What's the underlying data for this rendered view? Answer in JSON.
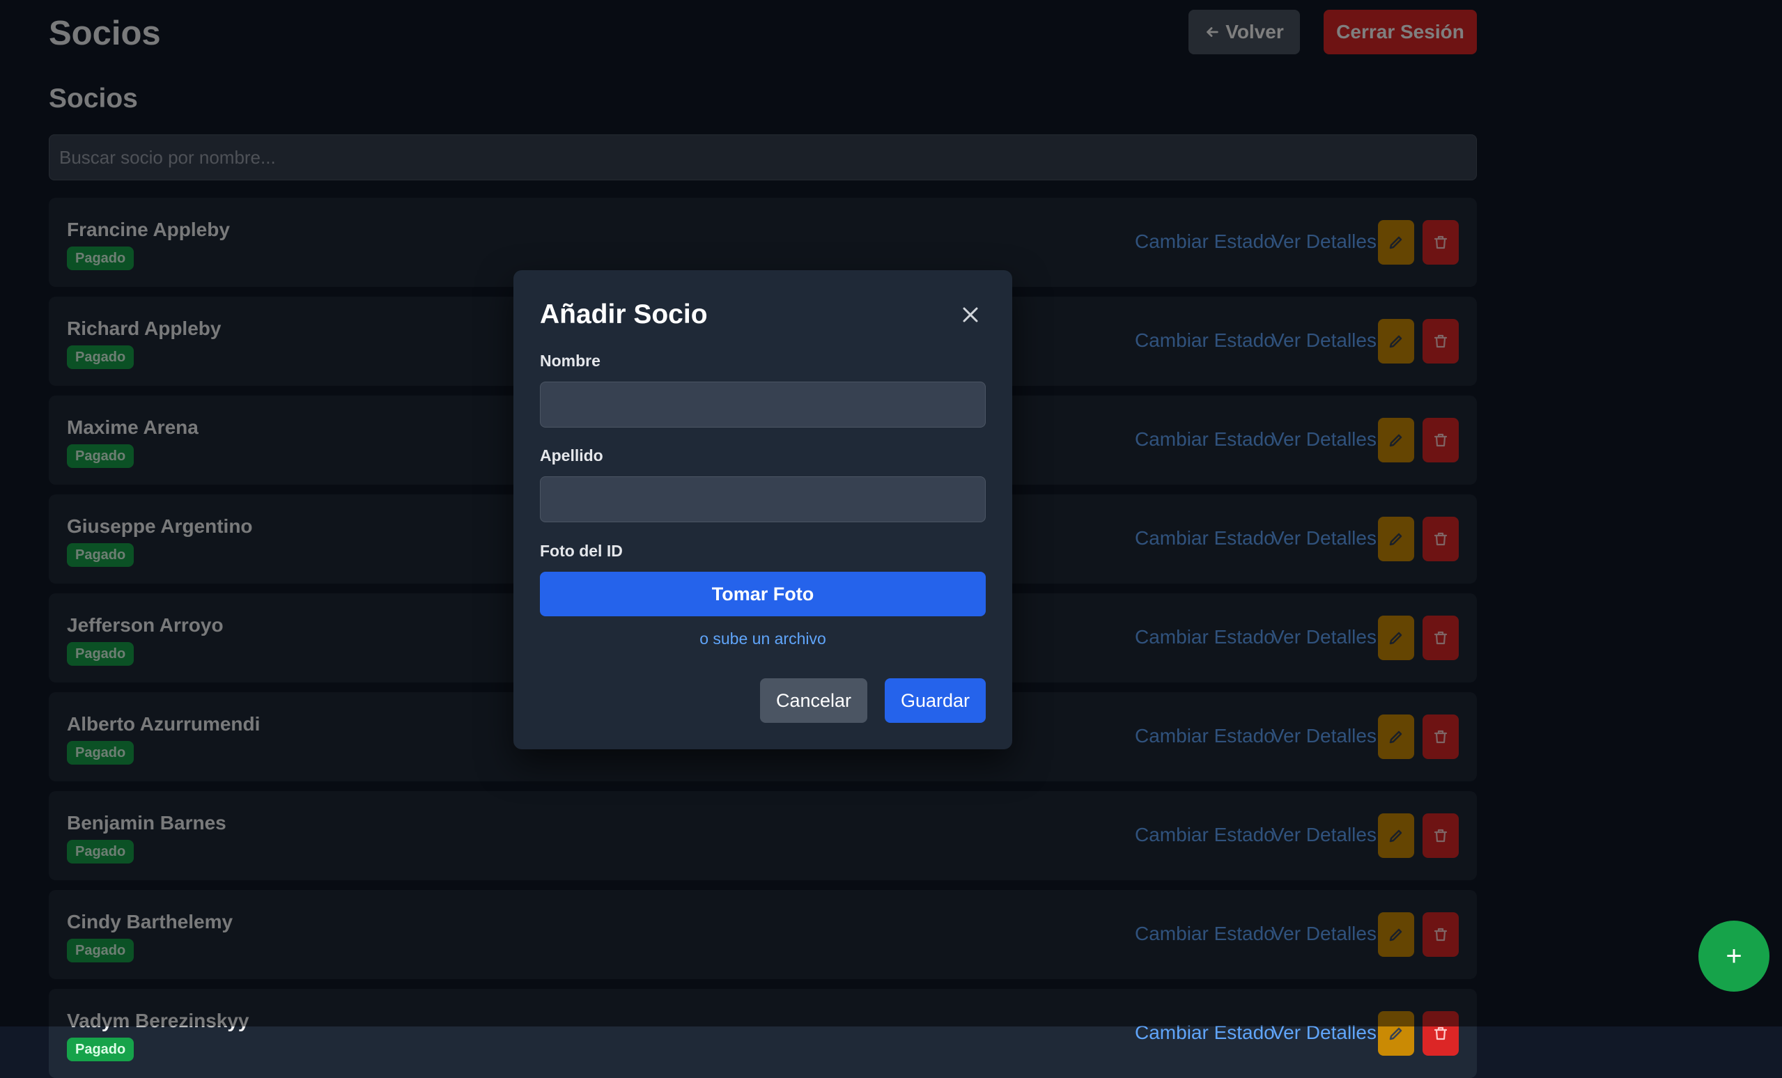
{
  "header": {
    "title": "Socios",
    "back_label": "Volver",
    "logout_label": "Cerrar Sesión"
  },
  "section_title": "Socios",
  "search": {
    "placeholder": "Buscar socio por nombre...",
    "value": ""
  },
  "members": [
    {
      "name": "Francine Appleby",
      "status": "Pagado"
    },
    {
      "name": "Richard Appleby",
      "status": "Pagado"
    },
    {
      "name": "Maxime Arena",
      "status": "Pagado"
    },
    {
      "name": "Giuseppe Argentino",
      "status": "Pagado"
    },
    {
      "name": "Jefferson Arroyo",
      "status": "Pagado"
    },
    {
      "name": "Alberto Azurrumendi",
      "status": "Pagado"
    },
    {
      "name": "Benjamin Barnes",
      "status": "Pagado"
    },
    {
      "name": "Cindy Barthelemy",
      "status": "Pagado"
    },
    {
      "name": "Vadym Berezinskyy",
      "status": "Pagado"
    }
  ],
  "row_actions": {
    "change_status_label": "Cambiar Estado",
    "details_label": "Ver Detalles",
    "edit_icon": "pencil-icon",
    "delete_icon": "trash-icon"
  },
  "modal": {
    "title": "Añadir Socio",
    "first_name_label": "Nombre",
    "first_name_value": "",
    "last_name_label": "Apellido",
    "last_name_value": "",
    "photo_label": "Foto del ID",
    "take_photo_label": "Tomar Foto",
    "upload_label": "o sube un archivo",
    "cancel_label": "Cancelar",
    "save_label": "Guardar"
  },
  "fab": {
    "icon": "plus-icon",
    "label": "+"
  },
  "colors": {
    "background": "#111827",
    "card": "#1f2937",
    "badge_paid": "#16a34a",
    "primary": "#2563eb",
    "danger": "#dc2626",
    "warning": "#ca8a04",
    "link": "#60a5fa"
  }
}
